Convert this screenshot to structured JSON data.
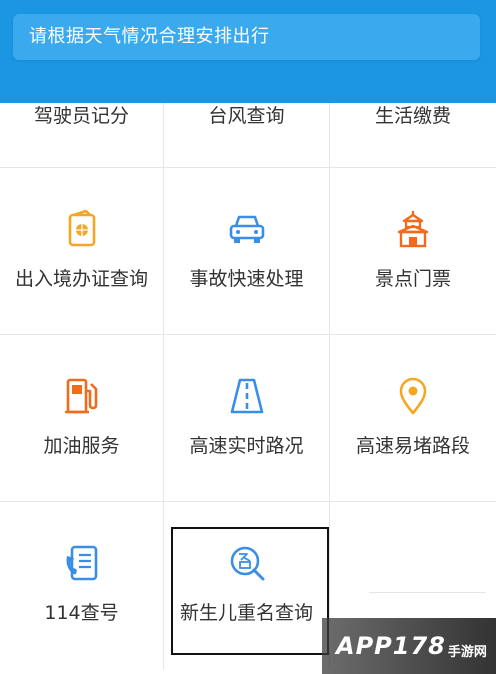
{
  "banner": {
    "message": "请根据天气情况合理安排出行"
  },
  "grid": {
    "row0": [
      "驾驶员记分",
      "台风查询",
      "生活缴费"
    ],
    "row1": [
      "出入境办证查询",
      "事故快速处理",
      "景点门票"
    ],
    "row2": [
      "加油服务",
      "高速实时路况",
      "高速易堵路段"
    ],
    "row3": [
      "114查号",
      "新生儿重名查询"
    ]
  },
  "icons": {
    "passport": "passport-icon",
    "car": "car-icon",
    "temple": "temple-icon",
    "fuel": "fuel-pump-icon",
    "road": "highway-icon",
    "pin": "location-pin-icon",
    "phone": "phone-book-icon",
    "name": "name-search-icon"
  },
  "colors": {
    "brand_blue": "#1a96e3",
    "icon_orange": "#f5a623",
    "icon_blue": "#3a8ee6",
    "icon_red_orange": "#f26b1d"
  },
  "watermark": {
    "main": "APP178",
    "sub": "手游网"
  }
}
